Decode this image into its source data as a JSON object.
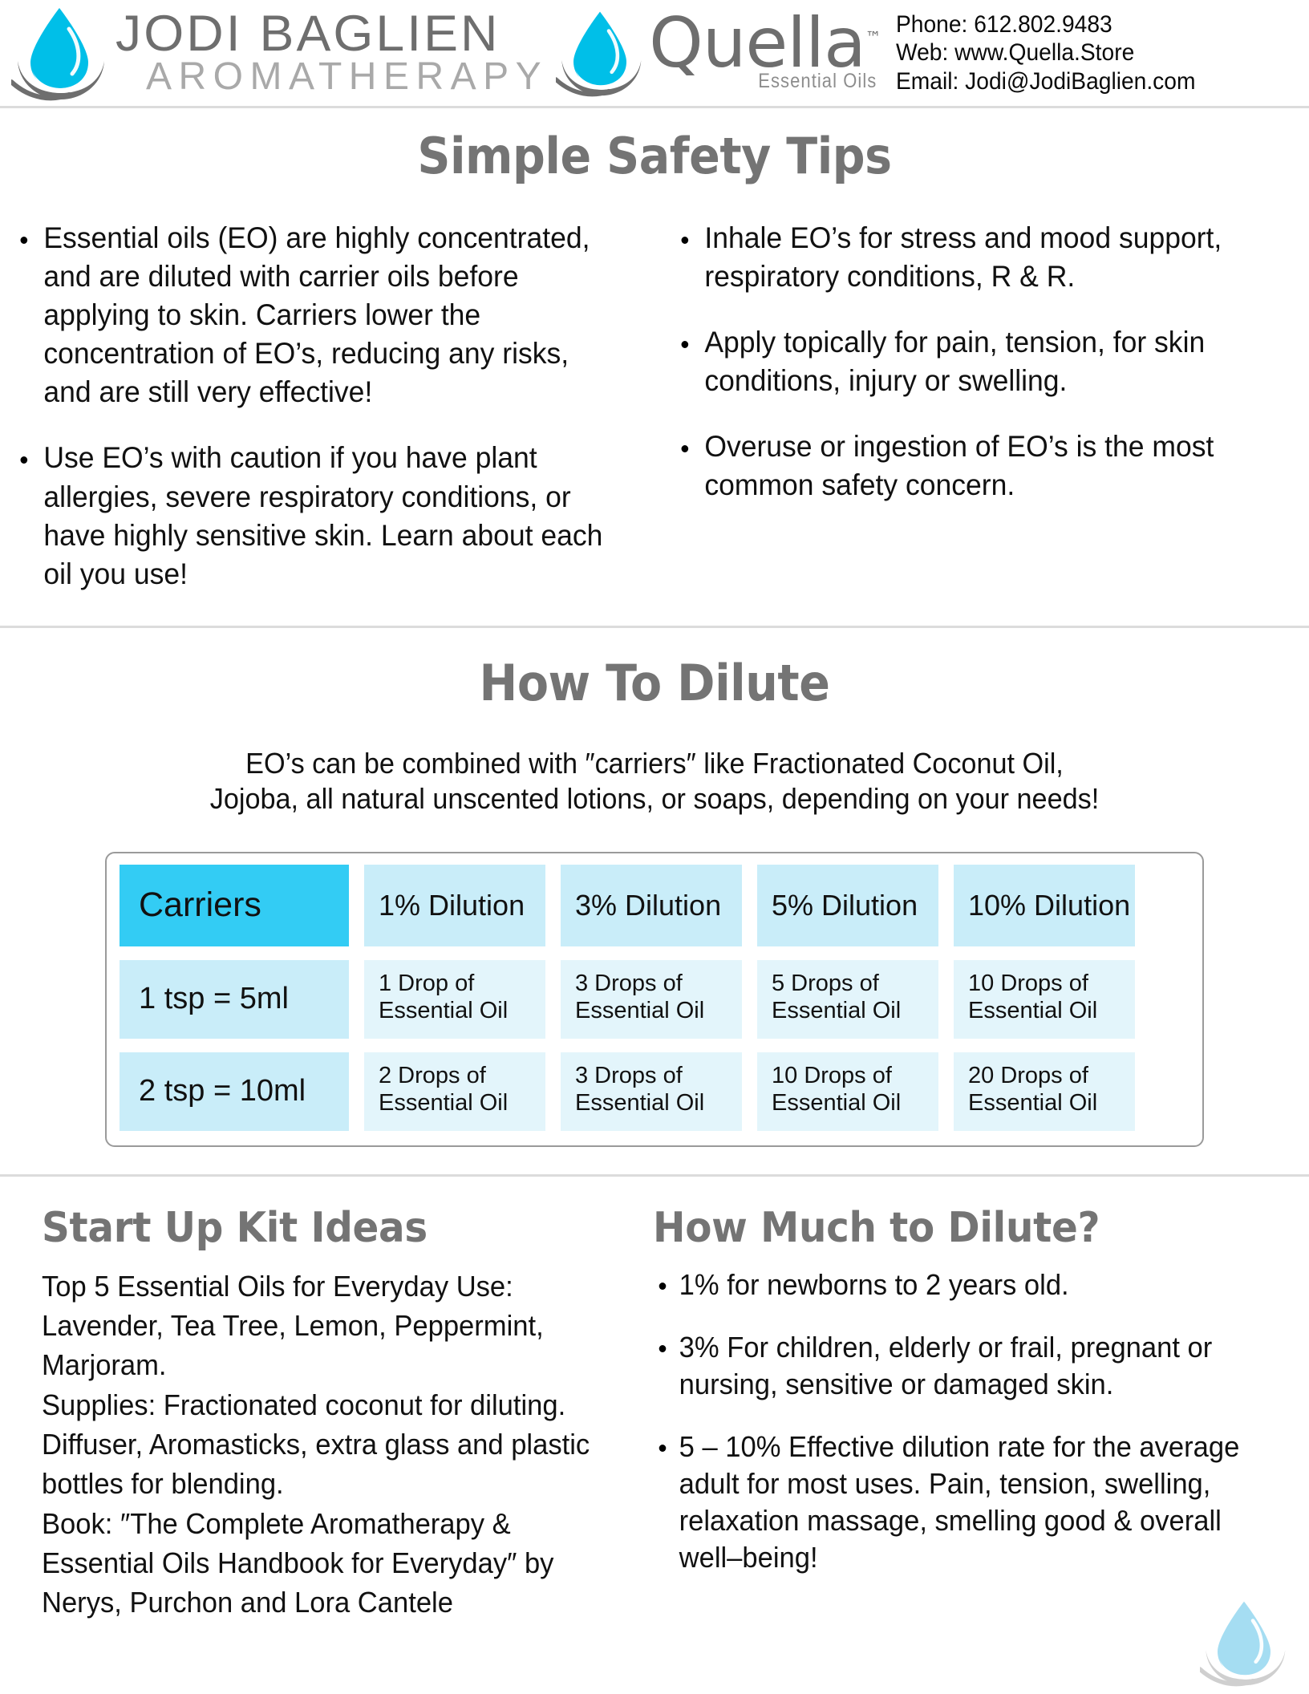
{
  "header": {
    "brand_line1": "JODI  BAGLIEN",
    "brand_line2": "AROMATHERAPY",
    "quella_word": "Quella",
    "quella_tm": "™",
    "quella_sub": "Essential Oils",
    "contact": {
      "phone": "Phone: 612.802.9483",
      "web": "Web: www.Quella.Store",
      "email": "Email: Jodi@JodiBaglien.com"
    },
    "logo_drop_color": "#00BFE8",
    "logo_swoosh_color": "#6e6e6e",
    "brand_line1_color": "#6e6e6e",
    "brand_line2_color": "#a9a9a9"
  },
  "safety": {
    "title": "Simple Safety Tips",
    "left_bullets": [
      "Essential oils (EO) are highly concentrated, and are diluted with carrier oils before applying to skin. Carriers lower the concentration of EO’s, reducing any risks, and are still very effective!",
      "Use EO’s with caution if you have plant allergies, severe respiratory conditions, or have highly sensitive skin. Learn about each oil you use!"
    ],
    "right_bullets": [
      "Inhale EO’s for stress and mood support, respiratory conditions, R & R.",
      "Apply topically for pain, tension, for skin conditions, injury or swelling.",
      "Overuse or ingestion of EO’s is the most common safety concern."
    ]
  },
  "dilute": {
    "title": "How To Dilute",
    "intro_line1": "EO’s can be combined with ″carriers″ like Fractionated Coconut Oil,",
    "intro_line2": "Jojoba, all natural unscented lotions, or soaps, depending on your needs!",
    "table": {
      "header": [
        "Carriers",
        "1% Dilution",
        "3% Dilution",
        "5% Dilution",
        "10% Dilution"
      ],
      "rows": [
        [
          "1 tsp = 5ml",
          "1 Drop of Essential Oil",
          "3 Drops of Essential Oil",
          "5 Drops of Essential Oil",
          "10 Drops of Essential Oil"
        ],
        [
          "2 tsp = 10ml",
          "2 Drops of Essential Oil",
          "3 Drops of Essential Oil",
          "10 Drops of Essential Oil",
          "20 Drops of Essential Oil"
        ]
      ],
      "colors": {
        "header_carrier_bg": "#33ccf4",
        "header_dilution_bg": "#c9edf9",
        "body_carrier_bg": "#c9edf9",
        "body_dilution_bg": "#e3f5fb",
        "border": "#9a9a9a"
      }
    }
  },
  "startup": {
    "title": "Start Up Kit Ideas",
    "body": "Top 5 Essential Oils for Everyday Use: Lavender, Tea Tree, Lemon, Peppermint, Marjoram.\nSupplies: Fractionated coconut for diluting. Diffuser, Aromasticks, extra glass and plastic bottles for blending.\nBook: ″The Complete Aromatherapy & Essential Oils Handbook for Everyday″ by Nerys, Purchon and Lora Cantele"
  },
  "howmuch": {
    "title": "How Much to Dilute?",
    "bullets": [
      "1% for newborns to 2 years old.",
      "3% For children, elderly or frail, pregnant or nursing, sensitive or damaged skin.",
      "5 – 10% Effective dilution rate for the average adult for most uses. Pain, tension, swelling, relaxation massage, smelling good & overall well–being!"
    ]
  }
}
